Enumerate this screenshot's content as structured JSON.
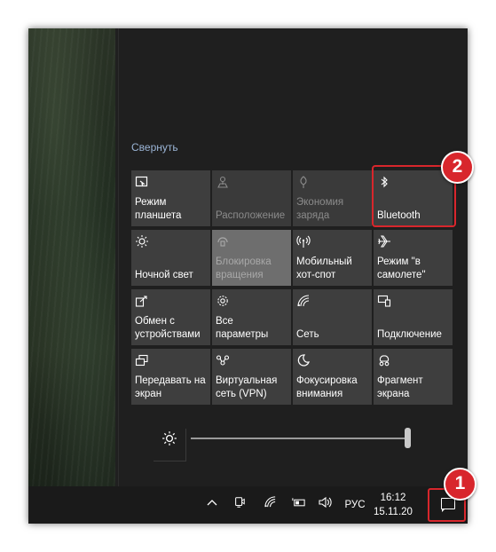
{
  "action_center": {
    "collapse_label": "Свернуть",
    "tiles": [
      {
        "label": "Режим\nпланшета",
        "icon": "tablet-mode-icon",
        "state": "off"
      },
      {
        "label": "Расположение",
        "icon": "location-icon",
        "state": "disabled"
      },
      {
        "label": "Экономия\nзаряда",
        "icon": "battery-saver-icon",
        "state": "disabled"
      },
      {
        "label": "Bluetooth",
        "icon": "bluetooth-icon",
        "state": "off"
      },
      {
        "label": "Ночной свет",
        "icon": "night-light-icon",
        "state": "off"
      },
      {
        "label": "Блокировка\nвращения",
        "icon": "rotation-lock-icon",
        "state": "disabled-light"
      },
      {
        "label": "Мобильный\nхот-спот",
        "icon": "hotspot-icon",
        "state": "off"
      },
      {
        "label": "Режим \"в\nсамолете\"",
        "icon": "airplane-icon",
        "state": "off"
      },
      {
        "label": "Обмен с\nустройствами",
        "icon": "nearby-sharing-icon",
        "state": "off"
      },
      {
        "label": "Все\nпараметры",
        "icon": "settings-gear-icon",
        "state": "off"
      },
      {
        "label": "Сеть",
        "icon": "network-icon",
        "state": "off"
      },
      {
        "label": "Подключение",
        "icon": "connect-icon",
        "state": "off"
      },
      {
        "label": "Передавать на\nэкран",
        "icon": "project-icon",
        "state": "off"
      },
      {
        "label": "Виртуальная\nсеть (VPN)",
        "icon": "vpn-icon",
        "state": "off"
      },
      {
        "label": "Фокусировка\nвнимания",
        "icon": "focus-assist-icon",
        "state": "off"
      },
      {
        "label": "Фрагмент\nэкрана",
        "icon": "screen-snip-icon",
        "state": "off"
      }
    ],
    "brightness_level": 1.0
  },
  "taskbar": {
    "language": "РУС",
    "time": "16:12",
    "date": "15.11.20"
  },
  "annotations": {
    "badge_1": "1",
    "badge_2": "2",
    "color": "#d8262c"
  }
}
